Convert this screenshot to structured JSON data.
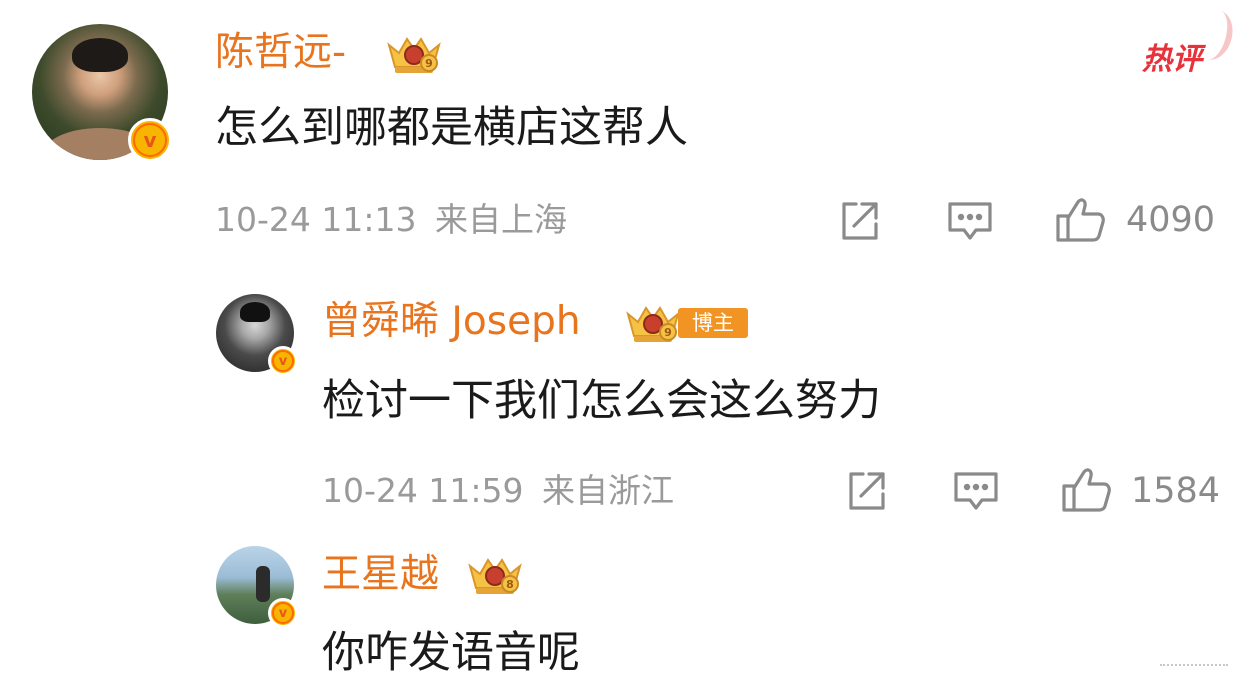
{
  "comment": {
    "author": "陈哲远-",
    "text": "怎么到哪都是横店这帮人",
    "time": "10-24 11:13",
    "location": "来自上海",
    "likes": "4090",
    "hot_label": "热评",
    "fan_level": "9"
  },
  "replies": [
    {
      "author": "曾舜晞 Joseph",
      "tag": "博主",
      "fan_level": "9",
      "text": "检讨一下我们怎么会这么努力",
      "time": "10-24 11:59",
      "location": "来自浙江",
      "likes": "1584"
    },
    {
      "author": "王星越",
      "fan_level": "8",
      "text": "你咋发语音呢"
    }
  ],
  "icons": {
    "verified": "verified-v-icon",
    "fan_crown": "crown-badge-icon",
    "share": "share-external-icon",
    "comment": "comment-bubble-icon",
    "like": "thumbs-up-icon"
  },
  "colors": {
    "name": "#e8741e",
    "hot": "#e8323b",
    "verified": "#f7b500",
    "meta": "#9a9a9a"
  }
}
